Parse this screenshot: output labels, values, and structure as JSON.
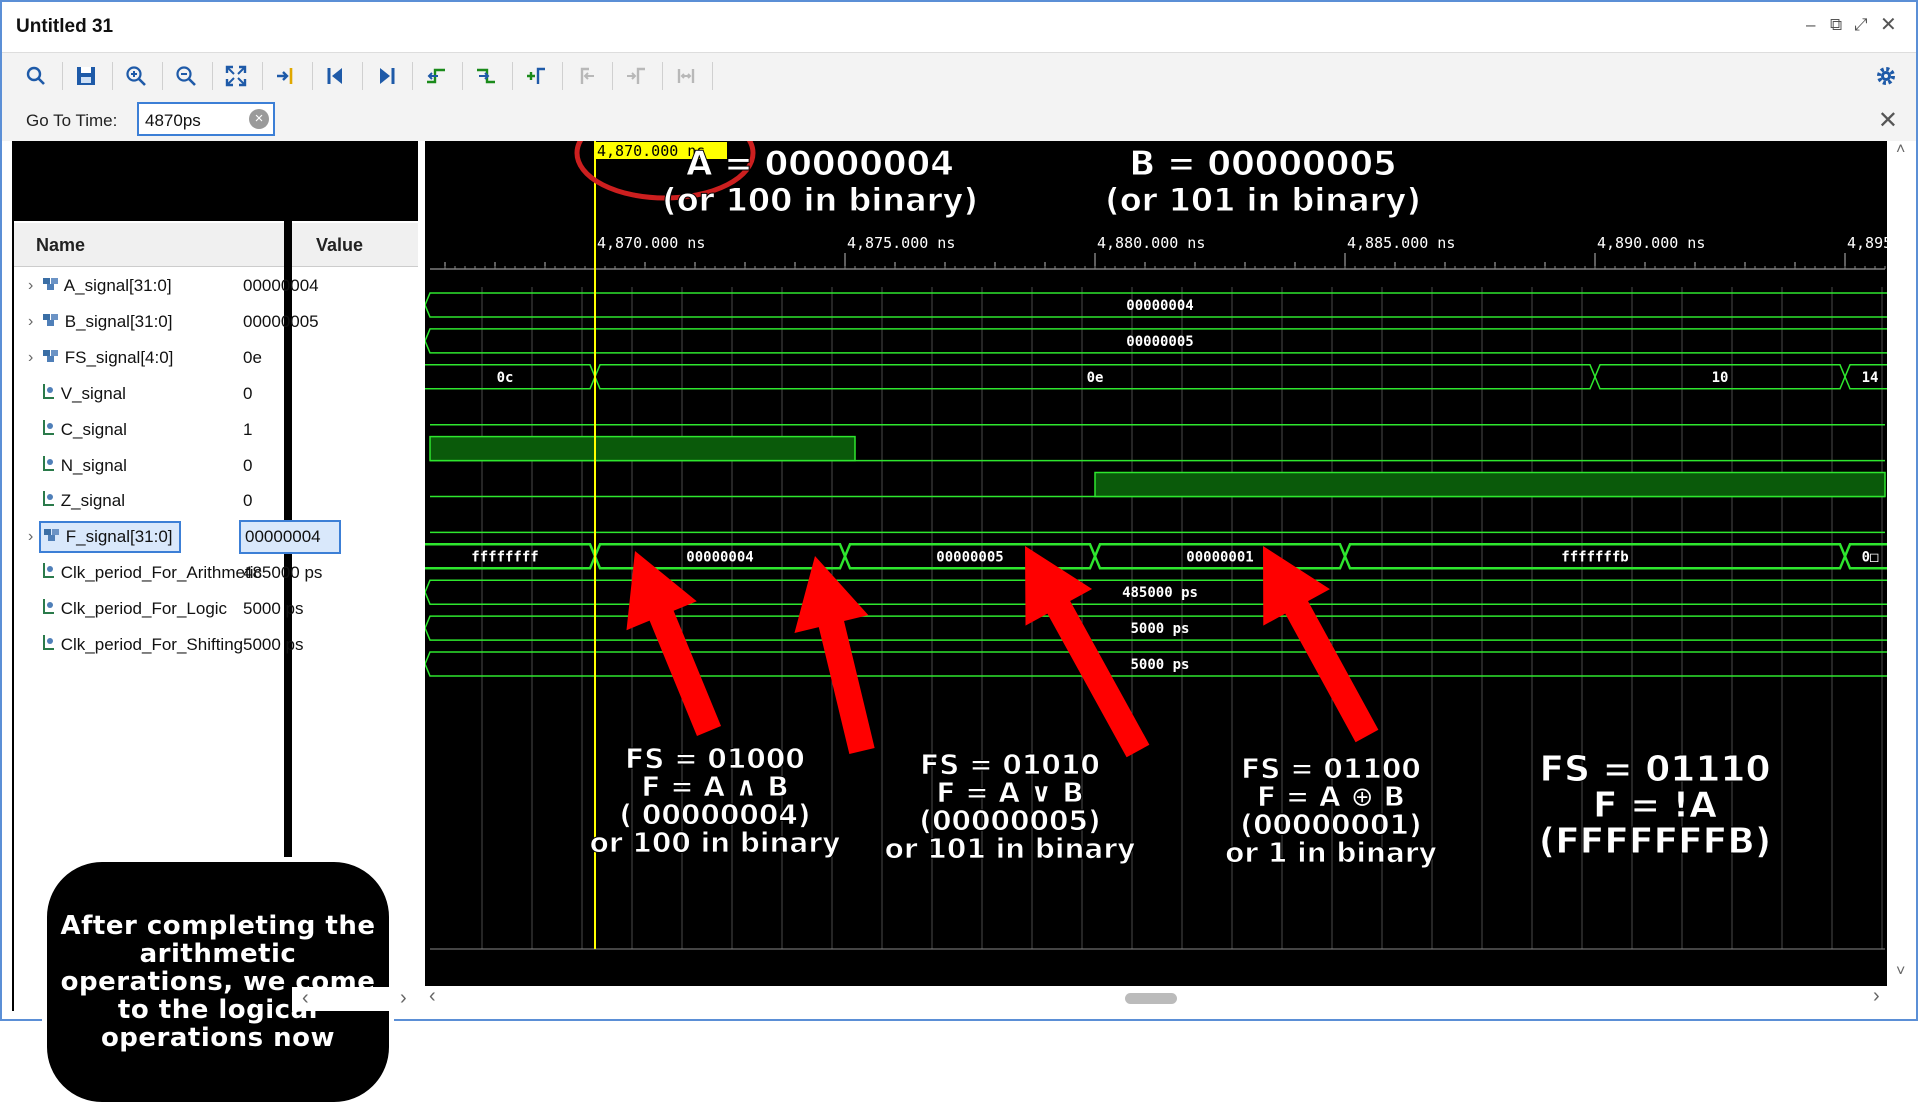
{
  "window": {
    "title": "Untitled 31",
    "controls": [
      "minimize-icon",
      "restore-icon",
      "maximize-icon",
      "close-icon"
    ]
  },
  "toolbar": {
    "icons": [
      "search-icon",
      "save-icon",
      "zoom-in-icon",
      "zoom-out-icon",
      "zoom-fit-icon",
      "go-to-cursor-icon",
      "go-to-time-zero-icon",
      "go-to-last-time-icon",
      "previous-transition-icon",
      "next-transition-icon",
      "add-marker-icon",
      "previous-marker-icon",
      "next-marker-icon",
      "swap-cursors-icon",
      "settings-icon"
    ]
  },
  "goto": {
    "label": "Go To Time:",
    "value": "4870ps"
  },
  "columns": {
    "name": "Name",
    "value": "Value"
  },
  "signals": [
    {
      "name": "A_signal[31:0]",
      "value": "00000004",
      "kind": "bus",
      "expandable": true
    },
    {
      "name": "B_signal[31:0]",
      "value": "00000005",
      "kind": "bus",
      "expandable": true
    },
    {
      "name": "FS_signal[4:0]",
      "value": "0e",
      "kind": "bus",
      "expandable": true
    },
    {
      "name": "V_signal",
      "value": "0",
      "kind": "bit",
      "expandable": false
    },
    {
      "name": "C_signal",
      "value": "1",
      "kind": "bit",
      "expandable": false
    },
    {
      "name": "N_signal",
      "value": "0",
      "kind": "bit",
      "expandable": false
    },
    {
      "name": "Z_signal",
      "value": "0",
      "kind": "bit",
      "expandable": false
    },
    {
      "name": "F_signal[31:0]",
      "value": "00000004",
      "kind": "bus",
      "expandable": true,
      "selected": true
    },
    {
      "name": "Clk_period_For_Arithmetic",
      "value": "485000 ps",
      "kind": "bit",
      "expandable": false
    },
    {
      "name": "Clk_period_For_Logic",
      "value": "5000 ps",
      "kind": "bit",
      "expandable": false
    },
    {
      "name": "Clk_period_For_Shifting",
      "value": "5000 ps",
      "kind": "bit",
      "expandable": false
    }
  ],
  "waveform": {
    "cursor_label": "4,870.000 ns",
    "time_labels": [
      "4,870.000 ns",
      "4,875.000 ns",
      "4,880.000 ns",
      "4,885.000 ns",
      "4,890.000 ns",
      "4,895"
    ],
    "bus_values": {
      "A": "00000004",
      "B": "00000005",
      "FS": [
        "0c",
        "0e",
        "10",
        "14"
      ],
      "F": [
        "ffffffff",
        "00000004",
        "00000005",
        "00000001",
        "fffffffb",
        "0□"
      ],
      "clk_arith": "485000 ps",
      "clk_logic": "5000 ps",
      "clk_shift": "5000 ps"
    },
    "colors": {
      "wave": "#2ee62e",
      "fill": "#0a5a0a",
      "cursor": "#ffff00",
      "annotation_arrow": "#ff0000",
      "circle": "#cc1f1f"
    }
  },
  "annotations": {
    "a_line1": "A = 00000004",
    "a_line2": "(or 100 in binary)",
    "b_line1": "B = 00000005",
    "b_line2": "(or 101 in binary)",
    "and_block": [
      "FS = 01000",
      "F = A ∧ B",
      "( 00000004)",
      "or 100 in binary"
    ],
    "or_block": [
      "FS = 01010",
      "F = A ∨ B",
      "(00000005)",
      "or 101 in binary"
    ],
    "xor_block": [
      "FS = 01100",
      "F = A ⊕ B",
      "(00000001)",
      "or 1 in binary"
    ],
    "not_block": [
      "FS = 01110",
      "F = !A",
      "(FFFFFFFB)"
    ],
    "callout": [
      "After completing the",
      "arithmetic",
      "operations, we come",
      "to the logical",
      "operations now"
    ]
  }
}
